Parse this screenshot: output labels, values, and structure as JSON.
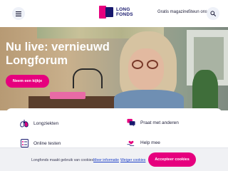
{
  "header": {
    "logo_line1": "LONG",
    "logo_line2": "FONDS",
    "nav": {
      "magazine": "Gratis magazine",
      "steun": "Steun ons"
    }
  },
  "hero": {
    "title": "Nu live: vernieuwd Longforum",
    "cta": "Neem een kijkje"
  },
  "cards": [
    {
      "label": "Longziekten",
      "icon": "lungs-icon"
    },
    {
      "label": "Praat met anderen",
      "icon": "chat-icon"
    },
    {
      "label": "Online testen",
      "icon": "checklist-icon"
    },
    {
      "label": "Help mee",
      "icon": "heart-hand-icon"
    }
  ],
  "cookie_bar": {
    "text": "Longfonds maakt gebruik van cookies.",
    "more_info": "Meer informatie",
    "decline": "Weiger cookies",
    "accept": "Accepteer cookies"
  },
  "colors": {
    "brand_pink": "#e6007e",
    "brand_navy": "#17186d",
    "link_blue": "#1e40c8"
  }
}
